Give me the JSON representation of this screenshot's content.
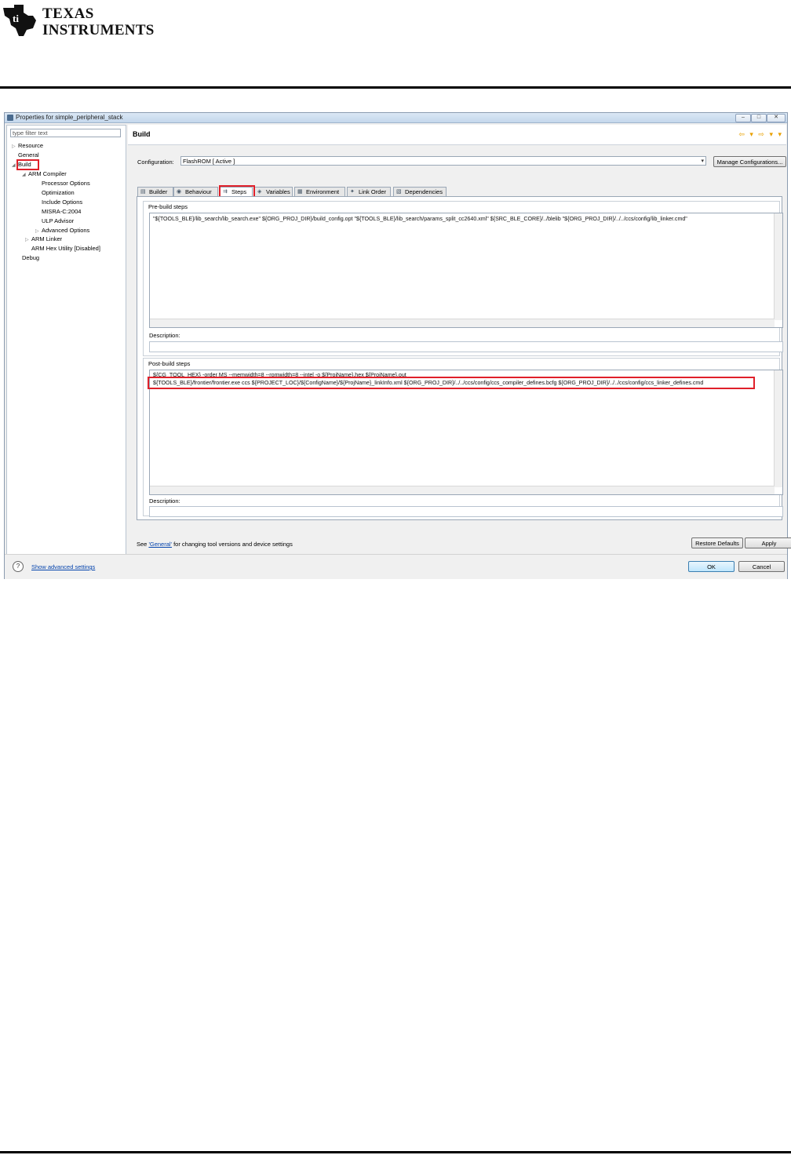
{
  "brand": {
    "line1": "TEXAS",
    "line2": "INSTRUMENTS"
  },
  "window": {
    "title": "Properties for simple_peripheral_stack",
    "controls": [
      "–",
      "□",
      "✕"
    ]
  },
  "filter": {
    "placeholder": "type filter text"
  },
  "tree": [
    {
      "label": "Resource",
      "expander": "▷"
    },
    {
      "label": "General",
      "expander": ""
    },
    {
      "label": "Build",
      "expander": "◢"
    },
    {
      "label": "ARM Compiler",
      "expander": "◢"
    },
    {
      "label": "Processor Options",
      "expander": ""
    },
    {
      "label": "Optimization",
      "expander": ""
    },
    {
      "label": "Include Options",
      "expander": ""
    },
    {
      "label": "MISRA-C:2004",
      "expander": ""
    },
    {
      "label": "ULP Advisor",
      "expander": ""
    },
    {
      "label": "Advanced Options",
      "expander": "▷"
    },
    {
      "label": "ARM Linker",
      "expander": "▷"
    },
    {
      "label": "ARM Hex Utility  [Disabled]",
      "expander": ""
    },
    {
      "label": "Debug",
      "expander": ""
    }
  ],
  "header": {
    "title": "Build",
    "nav": "⇦ ▾ ⇨ ▾ ▾"
  },
  "configuration": {
    "label": "Configuration:",
    "value": "FlashROM  [ Active ]",
    "manage_button": "Manage Configurations..."
  },
  "tabs": [
    {
      "label": "Builder",
      "icon": "▤"
    },
    {
      "label": "Behaviour",
      "icon": "◉"
    },
    {
      "label": "Steps",
      "icon": "⇉"
    },
    {
      "label": "Variables",
      "icon": "◈"
    },
    {
      "label": "Environment",
      "icon": "▦"
    },
    {
      "label": "Link Order",
      "icon": "✦"
    },
    {
      "label": "Dependencies",
      "icon": "▧"
    }
  ],
  "prebuild": {
    "label": "Pre-build steps",
    "command": "\"${TOOLS_BLE}/lib_search/lib_search.exe\" ${ORG_PROJ_DIR}/build_config.opt \"${TOOLS_BLE}/lib_search/params_split_cc2640.xml\" ${SRC_BLE_CORE}/../blelib \"${ORG_PROJ_DIR}/../../ccs/config/lib_linker.cmd\"",
    "description_label": "Description:"
  },
  "postbuild": {
    "label": "Post-build steps",
    "line1": "${CG_TOOL_HEX} -order MS --memwidth=8 --romwidth=8 --intel -o ${ProjName}.hex ${ProjName}.out",
    "line2": "${TOOLS_BLE}/frontier/frontier.exe ccs ${PROJECT_LOC}/${ConfigName}/${ProjName}_linkInfo.xml ${ORG_PROJ_DIR}/../../ccs/config/ccs_compiler_defines.bcfg ${ORG_PROJ_DIR}/../../ccs/config/ccs_linker_defines.cmd",
    "description_label": "Description:"
  },
  "footer": {
    "see_prefix": "See ",
    "see_link": "'General'",
    "see_suffix": " for changing tool versions and device settings",
    "restore_defaults": "Restore Defaults",
    "apply": "Apply",
    "help": "?",
    "advanced": "Show advanced settings",
    "ok": "OK",
    "cancel": "Cancel"
  },
  "colors": {
    "highlight": "#e0202a",
    "logo": "#111111",
    "link": "#0645ad"
  }
}
